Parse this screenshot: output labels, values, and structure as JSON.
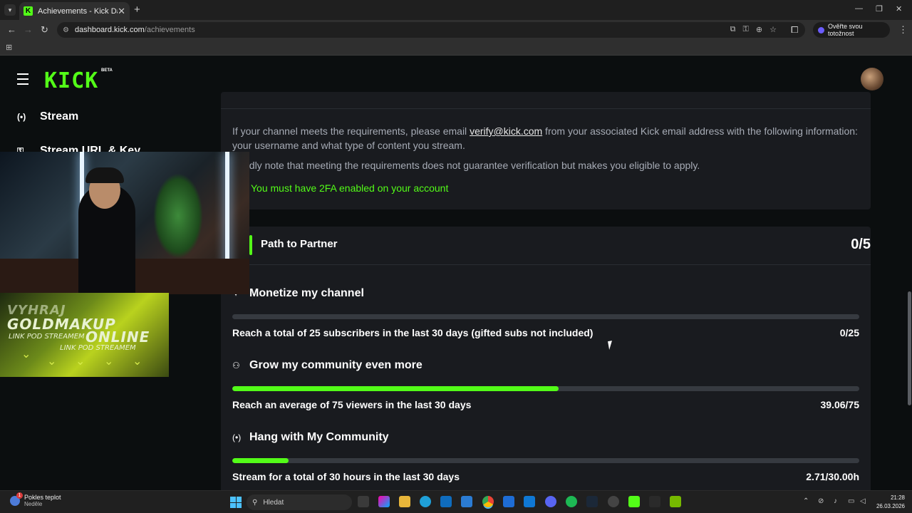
{
  "browser": {
    "tab_title": "Achievements - Kick Dashboard",
    "tab_close": "✕",
    "new_tab": "+",
    "url_host": "dashboard.kick.com",
    "url_path": "/achievements",
    "profile_button": "Ověřte svou totožnost"
  },
  "kick": {
    "logo": "KICK",
    "beta": "BETA"
  },
  "sidebar": {
    "items": [
      {
        "label": "Stream",
        "icon": "broadcast-icon"
      },
      {
        "label": "Stream URL & Key",
        "icon": "key-icon"
      }
    ]
  },
  "verification": {
    "requirements_text_prefix": "If your channel meets the requirements, please email ",
    "email": "verify@kick.com",
    "requirements_text_suffix": " from your associated Kick email address with the following information: your username and what type of content you stream.",
    "note": "ndly note that meeting the requirements does not guarantee verification but makes you eligible to apply.",
    "twofa_requirement": "You must have 2FA enabled on your account"
  },
  "path_to_partner": {
    "title": "Path to Partner",
    "progress": "0/5",
    "sections": [
      {
        "title": "Monetize my channel",
        "icon": "sparkle-icon",
        "requirement": "Reach a total of 25 subscribers in the last 30 days (gifted subs not included)",
        "value": "0/25",
        "fraction": 0.0
      },
      {
        "title": "Grow my community even more",
        "icon": "users-icon",
        "requirement": "Reach an average of 75 viewers in the last 30 days",
        "value": "39.06/75",
        "fraction": 0.5208
      },
      {
        "title": "Hang with My Community",
        "icon": "broadcast-icon",
        "requirement": "Stream for a total of 30 hours in the last 30 days",
        "value": "2.71/30.00h",
        "fraction": 0.09
      }
    ]
  },
  "overlay": {
    "promo_line1": "VYHRAJ",
    "promo_line2": "GOLDMAKUP",
    "promo_line3": "ONLINE",
    "promo_sub": "LINK POD STREAMEM"
  },
  "taskbar": {
    "weather_title": "Pokles teplot",
    "weather_sub": "Neděle",
    "search_placeholder": "Hledat",
    "time": "21:28",
    "date": "26.03.2026"
  },
  "colors": {
    "accent": "#53fc18",
    "card": "#191b1f",
    "page_bg": "#0b0e0f"
  }
}
